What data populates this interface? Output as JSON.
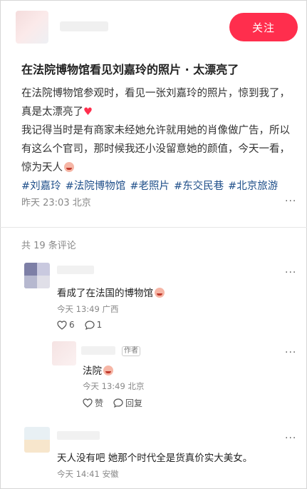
{
  "post": {
    "follow_label": "关注",
    "title": "在法院博物馆看见刘嘉玲的照片 · 太漂亮了",
    "paragraph1": "在法院博物馆参观时，看见一张刘嘉玲的照片，惊到我了，真是太漂亮了",
    "paragraph2": "我记得当时是有商家未经她允许就用她的肖像做广告，所以有这么个官司，那时候我还小没留意她的颜值，今天一看，惊为天人",
    "tags": [
      "#刘嘉玲",
      "#法院博物馆",
      "#老照片",
      "#东交民巷",
      "#北京旅游"
    ],
    "time_location": "昨天 23:03 北京",
    "heart_emoji": "♥"
  },
  "comments_header": "共 19 条评论",
  "comments": [
    {
      "text": "看成了在法国的博物馆",
      "meta": "今天 13:49 广西",
      "likes": "6",
      "replies": "1"
    },
    {
      "author_tag": "作者",
      "text": "法院",
      "meta": "今天 13:49 北京",
      "like_label": "赞",
      "reply_label": "回复"
    },
    {
      "text": "天人没有吧 她那个时代全是货真价实大美女。",
      "meta": "今天 14:41 安徽"
    }
  ],
  "more_icon": "···"
}
